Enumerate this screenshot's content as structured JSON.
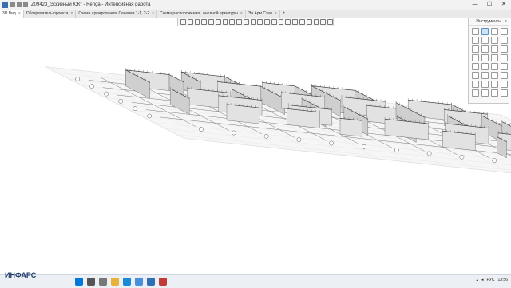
{
  "window": {
    "title": "Z09423_Эскизный КЖ* - Renga - Интенсивная работа",
    "controls": [
      "—",
      "☐",
      "✕"
    ]
  },
  "tabs": [
    {
      "label": "3D Вид",
      "close": "×"
    },
    {
      "label": "Обозреватель проекта",
      "close": "×"
    },
    {
      "label": "Схема армирования. Сечения 1-1, 2-2",
      "close": "×"
    },
    {
      "label": "Схема расположения...онолной арматуры",
      "close": "×"
    },
    {
      "label": "Эл.Арм.Стен",
      "close": "×"
    }
  ],
  "tab_add": "+",
  "tools_panel": {
    "title": "Инструменты",
    "close": "×",
    "count": 32
  },
  "axis_labels": [
    "Б",
    "В",
    "Г",
    "Д"
  ],
  "watermark": "ИНФАРС",
  "taskbar": {
    "lang": "РУС",
    "time": "13:56",
    "icons": [
      "windows-start-icon",
      "search-icon",
      "task-view-icon",
      "file-explorer-icon",
      "edge-icon",
      "mail-icon",
      "renga-icon",
      "app-icon"
    ]
  },
  "colors": {
    "accent": "#3a6fb0",
    "walls": "#dcdcdc",
    "grid": "#7a7a7a"
  }
}
